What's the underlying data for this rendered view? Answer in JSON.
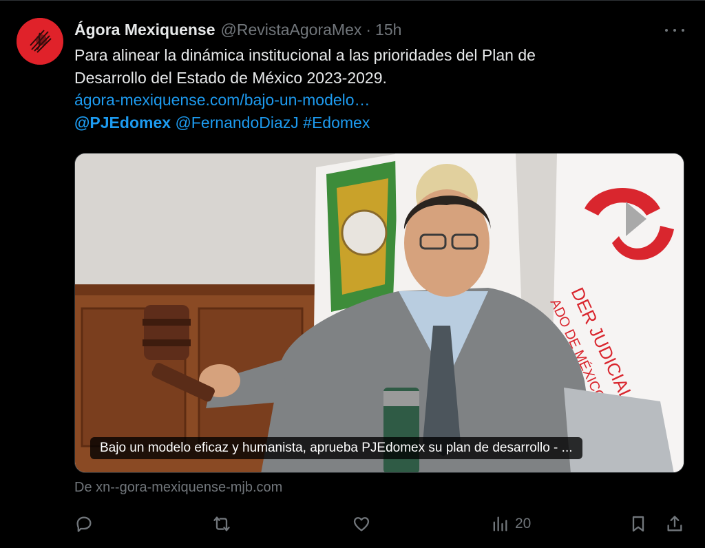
{
  "tweet": {
    "author_name": "Ágora Mexiquense",
    "handle": "@RevistaAgoraMex",
    "separator": "·",
    "time": "15h",
    "text_line1": "Para alinear la dinámica institucional a las prioridades del Plan de",
    "text_line2": "Desarrollo del Estado de México 2023-2029.",
    "link": "ágora-mexiquense.com/bajo-un-modelo…",
    "mention1": "@PJEdomex",
    "mention2": "@FernandoDiazJ",
    "hashtag": "#Edomex"
  },
  "card": {
    "caption": "Bajo un modelo eficaz y humanista, aprueba PJEdomex su plan de desarrollo - ...",
    "source": "De xn--gora-mexiquense-mjb.com",
    "image_flag_text_1": "DER JUDICIAL",
    "image_flag_text_2": "ADO DE MÉXICO"
  },
  "actions": {
    "views": "20"
  },
  "icons": {
    "reply": "reply-icon",
    "retweet": "retweet-icon",
    "like": "heart-icon",
    "views": "views-icon",
    "bookmark": "bookmark-icon",
    "share": "share-icon",
    "more": "more-icon"
  },
  "colors": {
    "background": "#000000",
    "link": "#1d9bf0",
    "muted": "#71767b",
    "avatar": "#e0222a"
  }
}
